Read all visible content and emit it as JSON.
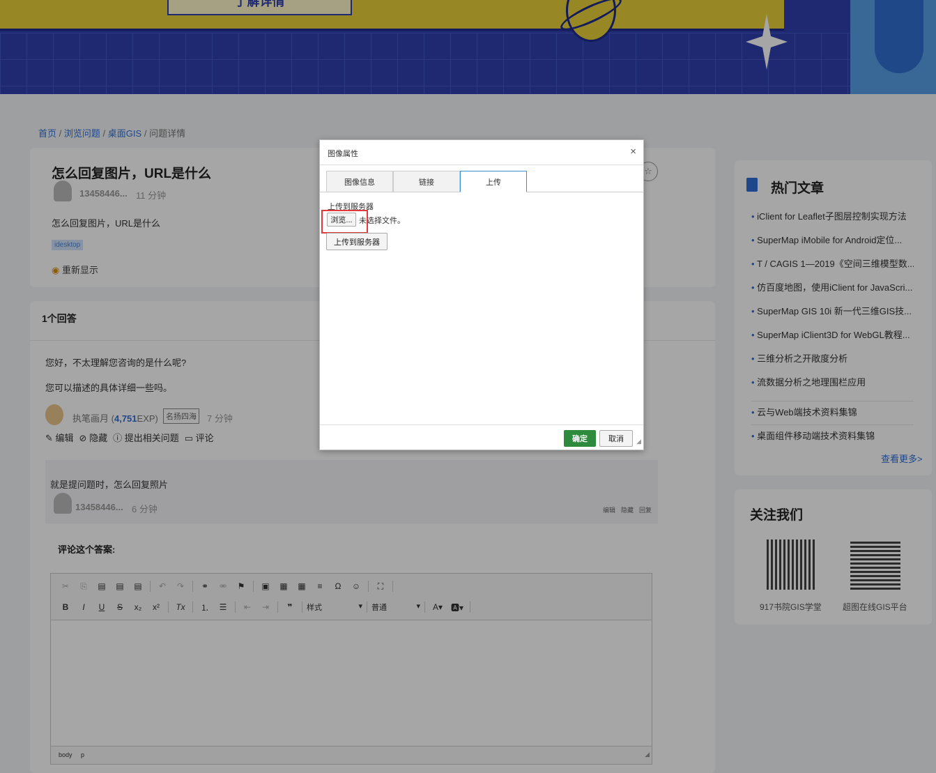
{
  "banner": {
    "ribbon_text": "了解详情"
  },
  "breadcrumb": {
    "home": "首页",
    "browse": "浏览问题",
    "category": "桌面GIS",
    "current": "问题详情",
    "sep": "/"
  },
  "question": {
    "title": "怎么回复图片，URL是什么",
    "author": "13458446...",
    "time": "11 分钟",
    "body": "怎么回复图片，URL是什么",
    "tag": "idesktop",
    "reshow": "重新显示"
  },
  "answers": {
    "count_label": "1个回答",
    "answer": {
      "line1": "您好，不太理解您咨询的是什么呢?",
      "line2": "您可以描述的具体详细一些吗。",
      "author": "执笔画月",
      "exp_open": "(",
      "exp": "4,751",
      "exp_close": "EXP)",
      "badge": "名扬四海",
      "time": "7 分钟",
      "actions": {
        "edit": "编辑",
        "hide": "隐藏",
        "ask": "提出相关问题",
        "comment": "评论"
      }
    },
    "comment": {
      "text": "就是提问题时，怎么回复照片",
      "author": "13458446...",
      "time": "6 分钟",
      "edit": "编辑",
      "hide": "隐藏",
      "reply": "回复"
    },
    "comment_form_title": "评论这个答案:"
  },
  "editor": {
    "style_label": "样式",
    "format_label": "普通",
    "path": [
      "body",
      "p"
    ]
  },
  "sidebar": {
    "hot_title": "热门文章",
    "articles": [
      "iClient for Leaflet子图层控制实现方法",
      "SuperMap iMobile for Android定位...",
      "T / CAGIS 1—2019《空间三维模型数...",
      "仿百度地图，使用iClient for JavaScri...",
      "SuperMap GIS 10i 新一代三维GIS技...",
      "SuperMap iClient3D for WebGL教程...",
      "三维分析之开敞度分析",
      "流数据分析之地理围栏应用",
      "云与Web端技术资料集锦",
      "桌面组件移动端技术资料集锦"
    ],
    "more": "查看更多>",
    "follow_title": "关注我们",
    "qr1": "917书院GIS学堂",
    "qr2": "超图在线GIS平台"
  },
  "dialog": {
    "title": "图像属性",
    "close": "×",
    "tabs": [
      "图像信息",
      "链接",
      "上传"
    ],
    "upload_label": "上传到服务器",
    "browse": "浏览...",
    "no_file": "未选择文件。",
    "upload_btn": "上传到服务器",
    "ok": "确定",
    "cancel": "取消"
  },
  "colors": {
    "accent": "#2f6fd6",
    "ok_green": "#2e8b3e",
    "highlight": "#e03a3a"
  }
}
